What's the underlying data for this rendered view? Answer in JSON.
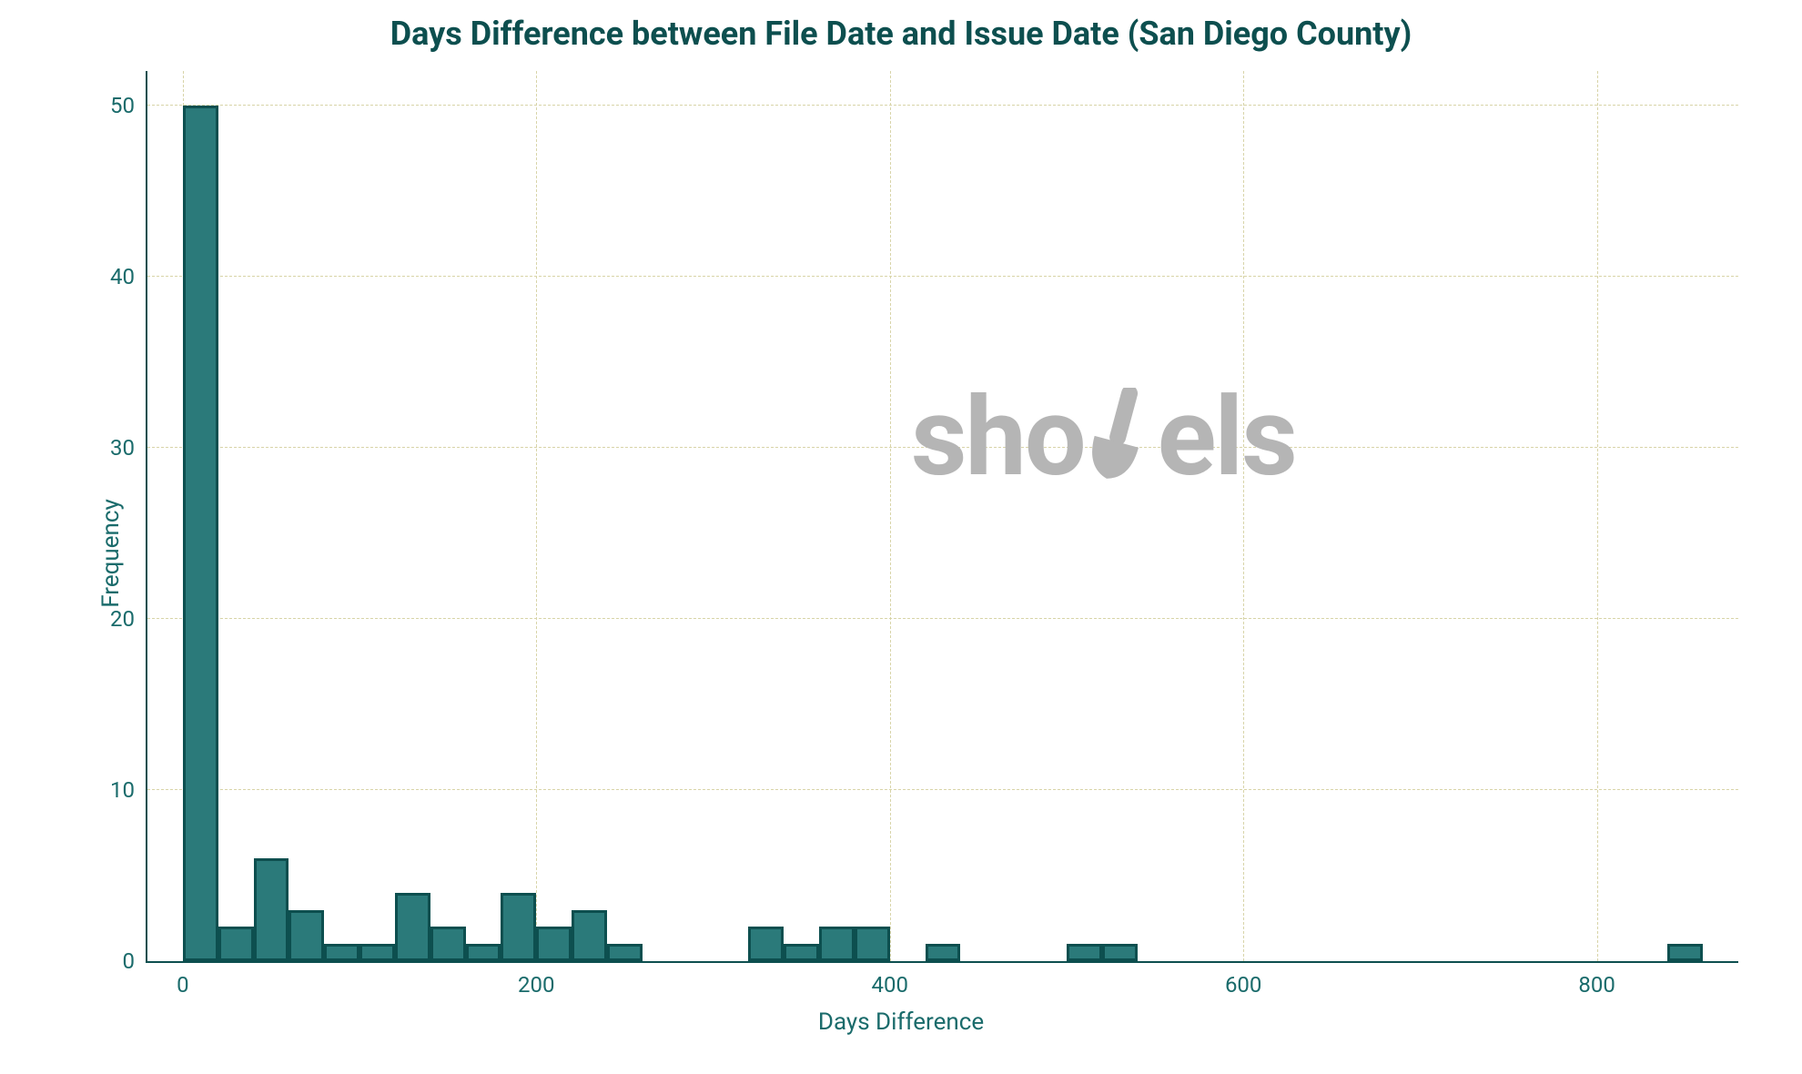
{
  "chart_data": {
    "type": "bar",
    "title": "Days Difference between File Date and Issue Date (San Diego County)",
    "xlabel": "Days Difference",
    "ylabel": "Frequency",
    "xlim": [
      -20,
      880
    ],
    "ylim": [
      0,
      52
    ],
    "xticks": [
      0,
      200,
      400,
      600,
      800
    ],
    "yticks": [
      0,
      10,
      20,
      30,
      40,
      50
    ],
    "bin_width": 20,
    "series": [
      {
        "name": "Frequency",
        "x_edges_start": 0,
        "values": [
          50,
          2,
          6,
          3,
          1,
          1,
          4,
          2,
          1,
          4,
          2,
          3,
          1,
          0,
          0,
          0,
          2,
          1,
          2,
          2,
          0,
          1,
          0,
          0,
          0,
          1,
          1,
          0,
          0,
          0,
          0,
          0,
          0,
          0,
          0,
          0,
          0,
          0,
          0,
          0,
          0,
          0,
          1
        ]
      }
    ],
    "watermark": "shovels"
  }
}
